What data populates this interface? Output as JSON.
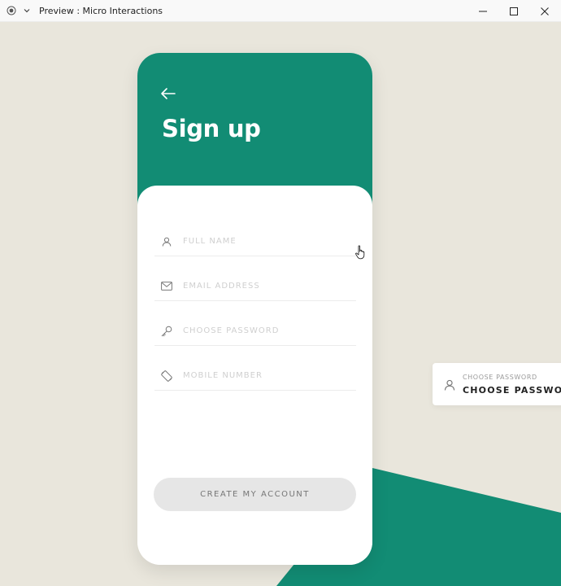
{
  "window": {
    "title": "Preview : Micro Interactions",
    "icons": {
      "app": "record-icon",
      "menu": "chevron-down-icon",
      "minimize": "minimize-icon",
      "maximize": "maximize-icon",
      "close": "close-icon"
    }
  },
  "colors": {
    "accent": "#128c74",
    "background": "#e9e6dc",
    "button": "#e6e6e6",
    "placeholder": "#cfcfcf"
  },
  "signup": {
    "title": "Sign up",
    "back_icon": "arrow-left-icon",
    "fields": [
      {
        "icon": "user-icon",
        "placeholder": "FULL NAME",
        "value": ""
      },
      {
        "icon": "mail-icon",
        "placeholder": "EMAIL ADDRESS",
        "value": ""
      },
      {
        "icon": "key-icon",
        "placeholder": "CHOOSE PASSWORD",
        "value": ""
      },
      {
        "icon": "phone-icon",
        "placeholder": "MOBILE NUMBER",
        "value": ""
      }
    ],
    "submit_label": "CREATE MY ACCOUNT"
  },
  "preview_card": {
    "icon": "user-icon",
    "caption": "CHOOSE PASSWORD",
    "label": "CHOOSE PASSWORD"
  }
}
